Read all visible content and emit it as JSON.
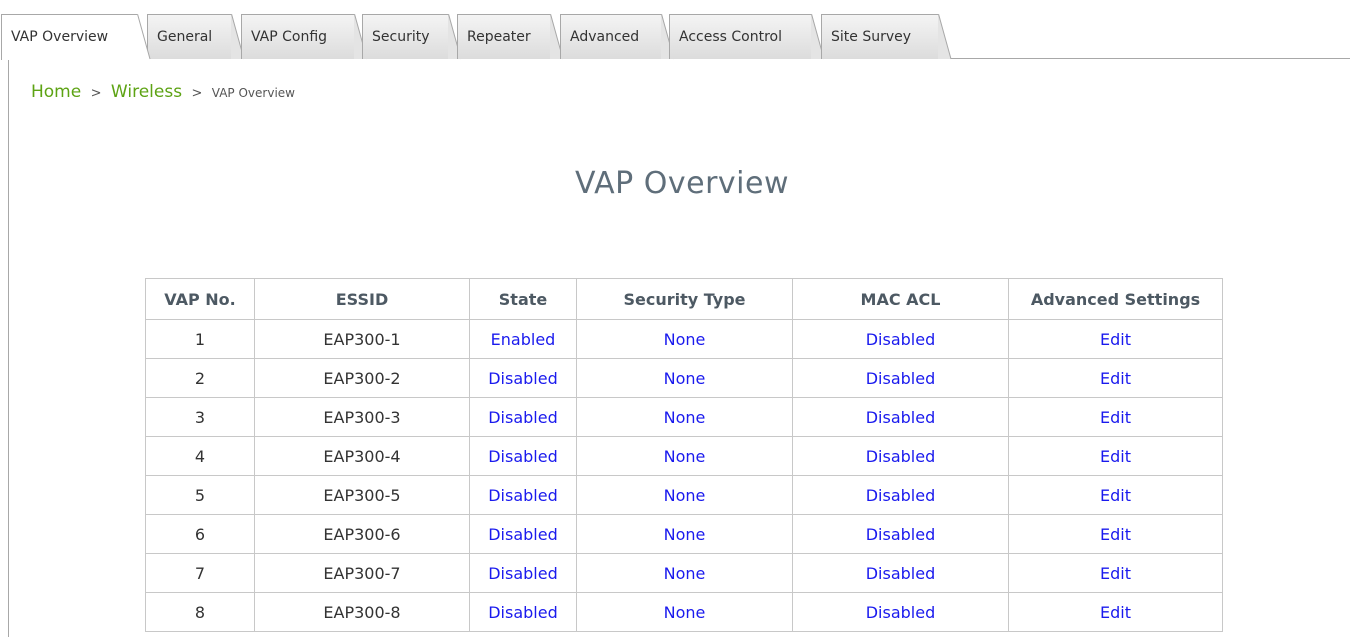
{
  "tabs": [
    {
      "label": "VAP Overview",
      "active": true
    },
    {
      "label": "General",
      "active": false
    },
    {
      "label": "VAP Config",
      "active": false
    },
    {
      "label": "Security",
      "active": false
    },
    {
      "label": "Repeater",
      "active": false
    },
    {
      "label": "Advanced",
      "active": false
    },
    {
      "label": "Access Control",
      "active": false
    },
    {
      "label": "Site Survey",
      "active": false
    }
  ],
  "breadcrumb": {
    "home": "Home",
    "wireless": "Wireless",
    "current": "VAP Overview",
    "separator": ">"
  },
  "page_title": "VAP Overview",
  "table": {
    "headers": {
      "vap_no": "VAP No.",
      "essid": "ESSID",
      "state": "State",
      "security_type": "Security Type",
      "mac_acl": "MAC ACL",
      "advanced_settings": "Advanced Settings"
    },
    "rows": [
      {
        "vap_no": "1",
        "essid": "EAP300-1",
        "state": "Enabled",
        "security_type": "None",
        "mac_acl": "Disabled",
        "advanced": "Edit"
      },
      {
        "vap_no": "2",
        "essid": "EAP300-2",
        "state": "Disabled",
        "security_type": "None",
        "mac_acl": "Disabled",
        "advanced": "Edit"
      },
      {
        "vap_no": "3",
        "essid": "EAP300-3",
        "state": "Disabled",
        "security_type": "None",
        "mac_acl": "Disabled",
        "advanced": "Edit"
      },
      {
        "vap_no": "4",
        "essid": "EAP300-4",
        "state": "Disabled",
        "security_type": "None",
        "mac_acl": "Disabled",
        "advanced": "Edit"
      },
      {
        "vap_no": "5",
        "essid": "EAP300-5",
        "state": "Disabled",
        "security_type": "None",
        "mac_acl": "Disabled",
        "advanced": "Edit"
      },
      {
        "vap_no": "6",
        "essid": "EAP300-6",
        "state": "Disabled",
        "security_type": "None",
        "mac_acl": "Disabled",
        "advanced": "Edit"
      },
      {
        "vap_no": "7",
        "essid": "EAP300-7",
        "state": "Disabled",
        "security_type": "None",
        "mac_acl": "Disabled",
        "advanced": "Edit"
      },
      {
        "vap_no": "8",
        "essid": "EAP300-8",
        "state": "Disabled",
        "security_type": "None",
        "mac_acl": "Disabled",
        "advanced": "Edit"
      }
    ]
  },
  "colors": {
    "link_blue": "#1a1aee",
    "breadcrumb_green": "#5da314",
    "title_gray": "#5f6e7a",
    "border": "#c8c8c8"
  }
}
